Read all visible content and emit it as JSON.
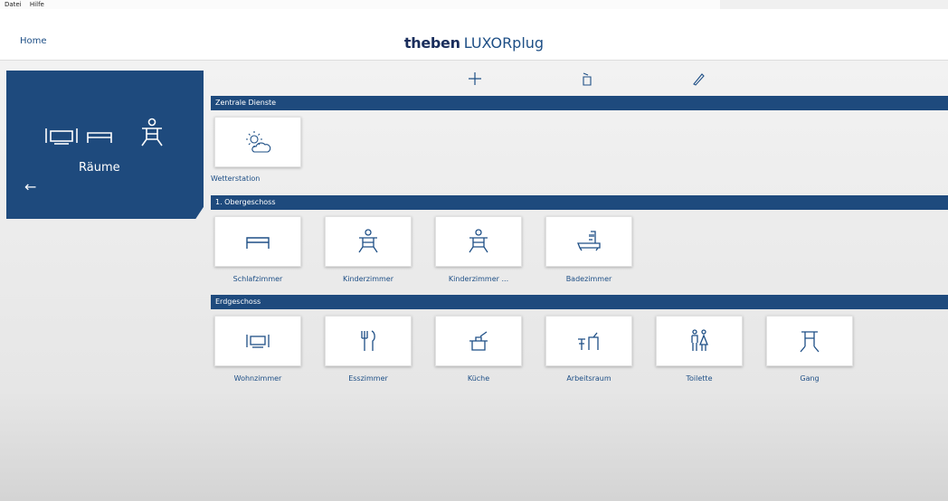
{
  "menu": {
    "file": "Datei",
    "help": "Hilfe"
  },
  "header": {
    "home": "Home",
    "logo": "theben",
    "product": "LUXORplug"
  },
  "sidebar": {
    "title": "Räume"
  },
  "sections": [
    {
      "title": "Zentrale Dienste",
      "rooms": [
        {
          "label": "Wetterstation",
          "icon": "weather-icon"
        }
      ]
    },
    {
      "title": "1. Obergeschoss",
      "rooms": [
        {
          "label": "Schlafzimmer",
          "icon": "bed-icon"
        },
        {
          "label": "Kinderzimmer",
          "icon": "child-icon"
        },
        {
          "label": "Kinderzimmer ...",
          "icon": "child-icon"
        },
        {
          "label": "Badezimmer",
          "icon": "bathtub-icon"
        }
      ]
    },
    {
      "title": "Erdgeschoss",
      "rooms": [
        {
          "label": "Wohnzimmer",
          "icon": "tv-icon"
        },
        {
          "label": "Esszimmer",
          "icon": "cutlery-icon"
        },
        {
          "label": "Küche",
          "icon": "cooking-pot-icon"
        },
        {
          "label": "Arbeitsraum",
          "icon": "desk-icon"
        },
        {
          "label": "Toilette",
          "icon": "toilet-icon"
        },
        {
          "label": "Gang",
          "icon": "hallway-lamp-icon"
        }
      ]
    }
  ]
}
